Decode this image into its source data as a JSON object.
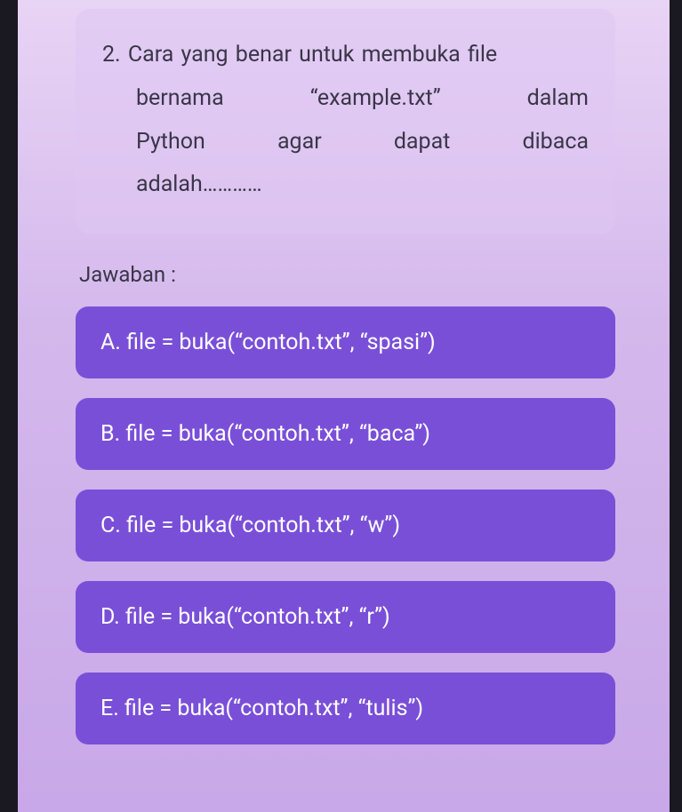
{
  "question": {
    "number": "2.",
    "line1": "2. Cara yang benar untuk membuka file",
    "line2_words": [
      "bernama",
      "“example.txt”",
      "dalam"
    ],
    "line3_words": [
      "Python",
      "agar",
      "dapat",
      "dibaca"
    ],
    "line4": "adalah…………"
  },
  "answers_label": "Jawaban :",
  "options": [
    {
      "letter": "A.",
      "text": "file = buka(“contoh.txt”, “spasi”)"
    },
    {
      "letter": "B.",
      "text": "file = buka(“contoh.txt”, “baca”)"
    },
    {
      "letter": "C.",
      "text": "file = buka(“contoh.txt”, “w”)"
    },
    {
      "letter": "D.",
      "text": "file = buka(“contoh.txt”, “r”)"
    },
    {
      "letter": "E.",
      "text": "file = buka(“contoh.txt”, “tulis”)"
    }
  ]
}
